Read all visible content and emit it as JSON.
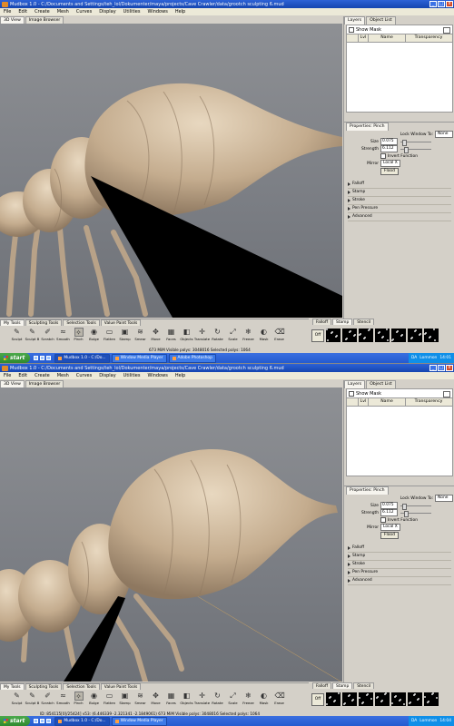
{
  "titlebar": {
    "title": "Mudbox 1.0 - C:/Documents and Settings/teh_lol/Dokumenter/maya/projects/Cave Crawler/data/grootch sculpting 6.mud",
    "min": "_",
    "max": "□",
    "close": "x"
  },
  "menu": [
    "File",
    "Edit",
    "Create",
    "Mesh",
    "Curves",
    "Display",
    "Utilities",
    "Windows",
    "Help"
  ],
  "view_tabs": [
    "3D View",
    "Image Browser"
  ],
  "right_tabs": [
    "Layers",
    "Object List"
  ],
  "layers": {
    "show_mask": "Show Mask",
    "columns": [
      "",
      "Lvl",
      "Name",
      "Transparency"
    ]
  },
  "properties": {
    "tab": "Properties: Pinch",
    "lock_label": "Lock Window To:",
    "lock_value": "None",
    "size_label": "Size",
    "size_value": "0.075",
    "strength_label": "Strength",
    "strength_value": "6.112",
    "invert_label": "Invert Function",
    "mirror_label": "Mirror",
    "mirror_value": "Local X",
    "flood": "Flood",
    "sections": [
      "Falloff",
      "Stamp",
      "Stroke",
      "Pen Pressure",
      "Advanced"
    ]
  },
  "tool_tabs": [
    "My Tools",
    "Sculpting Tools",
    "Selection Tools",
    "Value Paint Tools"
  ],
  "tools": [
    {
      "label": "Sculpt",
      "icon": "sculpt-icon"
    },
    {
      "label": "Sculpt B",
      "icon": "sculpt-b-icon"
    },
    {
      "label": "Scratch",
      "icon": "scratch-icon"
    },
    {
      "label": "Smooth",
      "icon": "smooth-icon"
    },
    {
      "label": "Pinch",
      "icon": "pinch-icon"
    },
    {
      "label": "Bulge",
      "icon": "bulge-icon"
    },
    {
      "label": "Flatten",
      "icon": "flatten-icon"
    },
    {
      "label": "Stamp",
      "icon": "stamp-icon"
    },
    {
      "label": "Smear",
      "icon": "smear-icon"
    },
    {
      "label": "Move",
      "icon": "move-icon"
    },
    {
      "label": "Faces",
      "icon": "faces-icon"
    },
    {
      "label": "Objects",
      "icon": "objects-icon"
    },
    {
      "label": "Translate",
      "icon": "translate-icon"
    },
    {
      "label": "Rotate",
      "icon": "rotate-icon"
    },
    {
      "label": "Scale",
      "icon": "scale-icon"
    },
    {
      "label": "Freeze",
      "icon": "freeze-icon"
    },
    {
      "label": "Mask",
      "icon": "mask-icon"
    },
    {
      "label": "Erase",
      "icon": "erase-icon"
    }
  ],
  "active_tool": "Pinch",
  "stamp_tabs": [
    "Falloff",
    "Stamp",
    "Stencil"
  ],
  "stamp_off": "Off",
  "screen1": {
    "status": "673 MiM   Visible polys: 3048016   Selected polys: 1064"
  },
  "screen2": {
    "status": "ID: 854115[0]/25424]  v53: (6.446339 -2.321341 -2.1849061)   673 MiM   Visible polys: 3048016   Selected polys: 1064"
  },
  "taskbar": {
    "start": "start",
    "buttons_1": [
      "Mudbox 1.0 - C:/Do...",
      "Window Media Player",
      "Adobe Photoshop"
    ],
    "buttons_2": [
      "Mudbox 1.0 - C:/Do...",
      "Window Media Player"
    ],
    "tray_1": [
      "DA",
      "Lommon",
      "14:01"
    ],
    "tray_2": [
      "DA",
      "Lommon",
      "14:04"
    ]
  },
  "colors": {
    "titlebar": "#245bd0",
    "viewport": "#7f8287",
    "model": "#c4ac8e",
    "cursor": "#000000"
  }
}
